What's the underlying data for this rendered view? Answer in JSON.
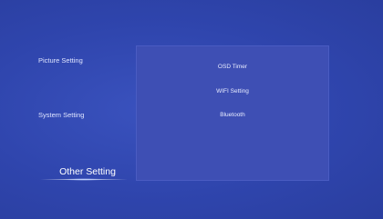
{
  "menu": {
    "items": [
      {
        "label": "Picture Setting"
      },
      {
        "label": "System Setting"
      },
      {
        "label": "Other Setting"
      }
    ],
    "active_index": 2
  },
  "panel": {
    "options": [
      {
        "label": "OSD Timer"
      },
      {
        "label": "WIFI Setting"
      },
      {
        "label": "Bluetooth"
      }
    ]
  },
  "colors": {
    "background": "#2f44ad",
    "panel": "#3e4fb4",
    "text": "#ffffff"
  }
}
